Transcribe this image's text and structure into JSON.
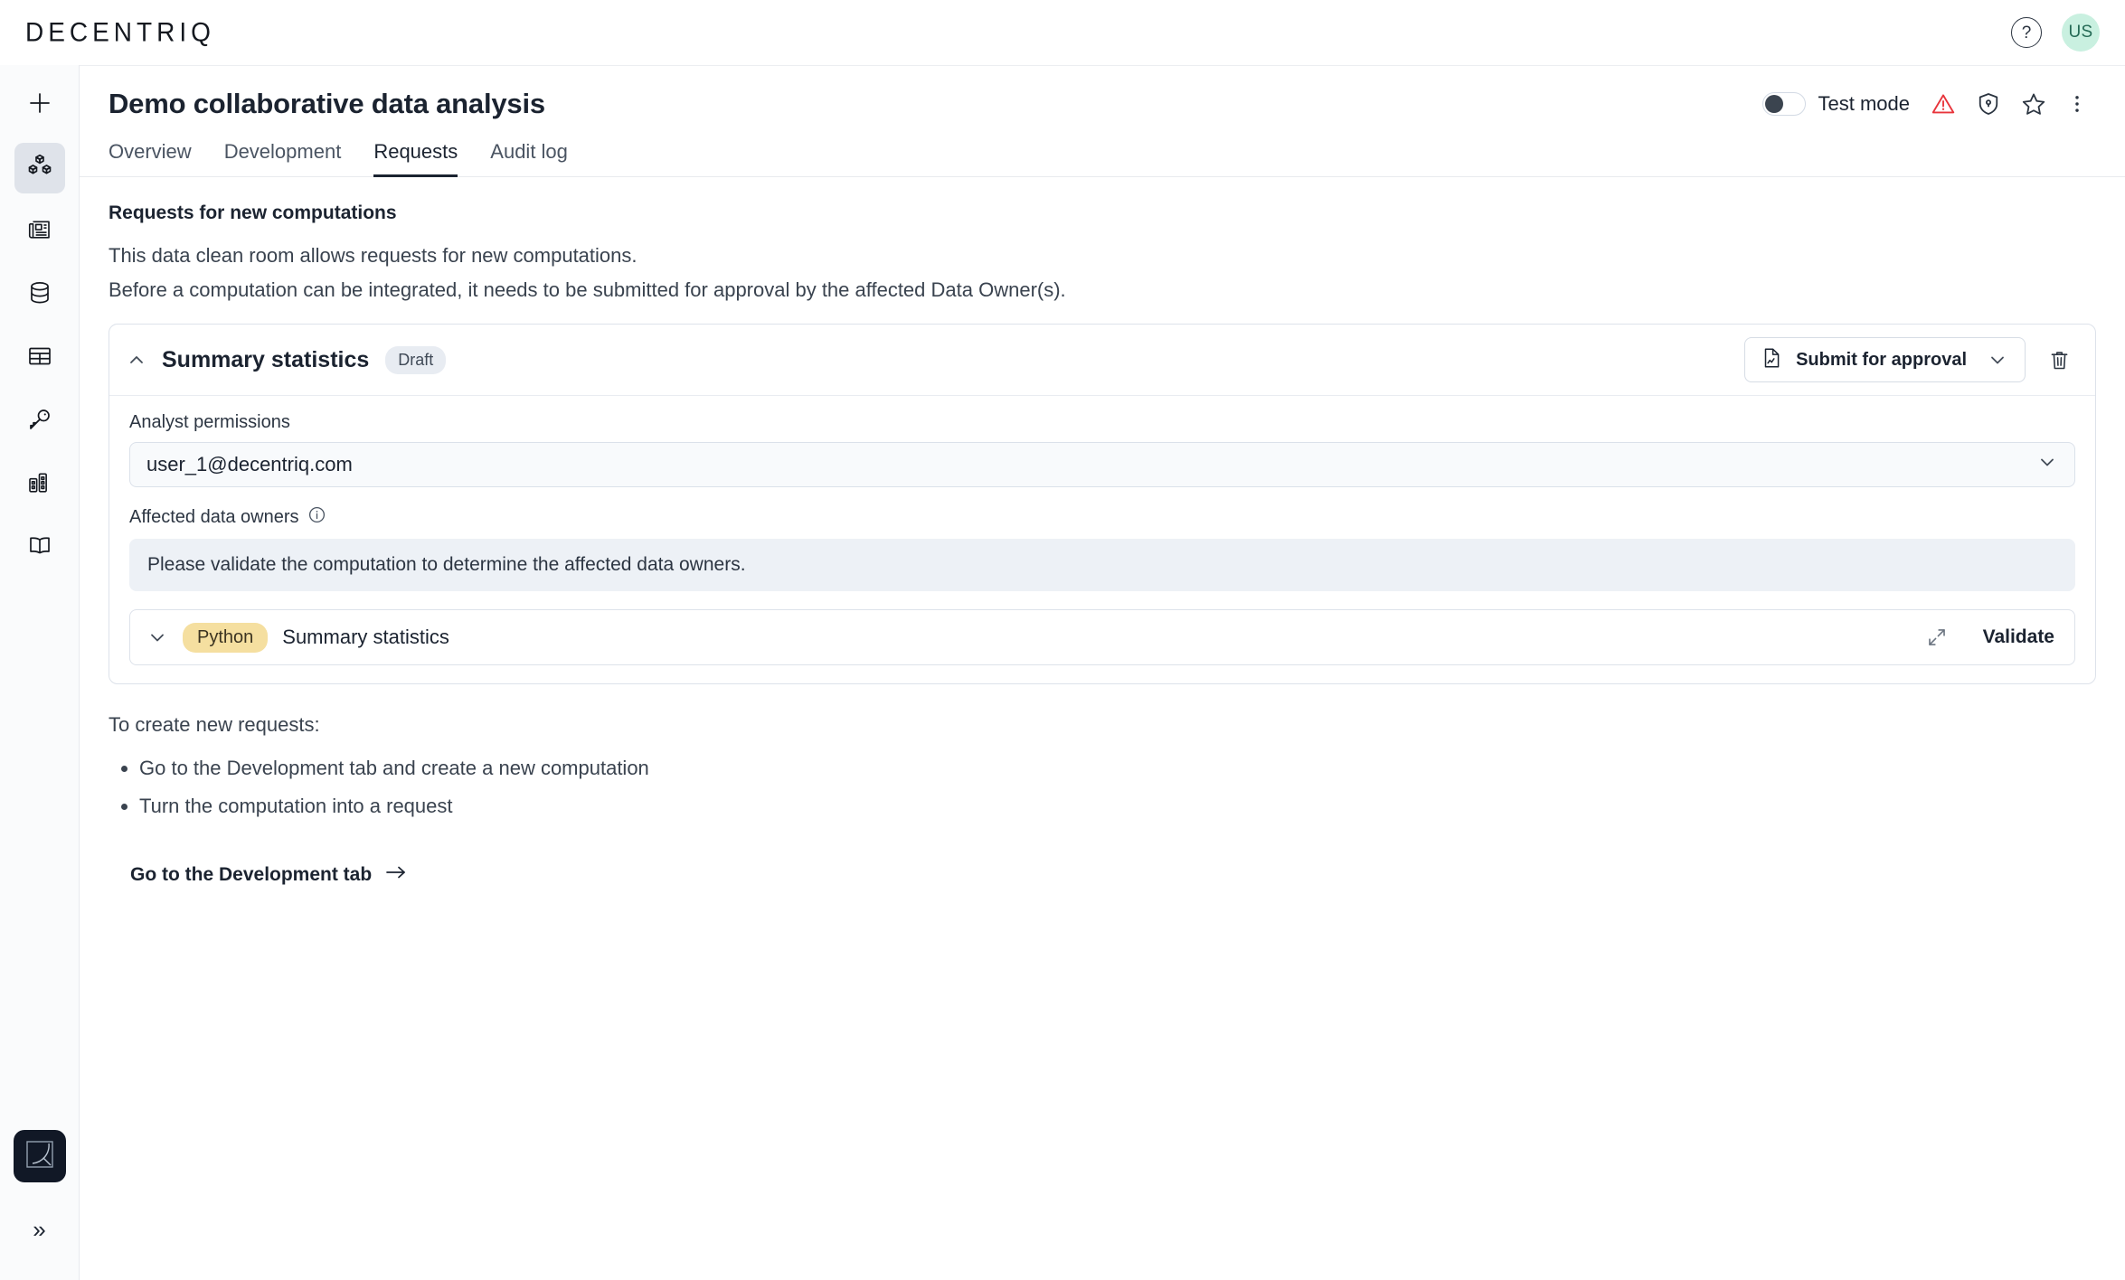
{
  "topbar": {
    "brand": "DECENTRIQ",
    "help_icon": "question-mark-circle-icon",
    "avatar_initials": "US",
    "avatar_bg": "#c9f0e0",
    "avatar_fg": "#246a55"
  },
  "sidebar": {
    "items": [
      {
        "icon": "plus-icon",
        "active": false
      },
      {
        "icon": "cubes-icon",
        "active": true
      },
      {
        "icon": "newspaper-icon",
        "active": false
      },
      {
        "icon": "database-icon",
        "active": false
      },
      {
        "icon": "table-icon",
        "active": false
      },
      {
        "icon": "key-icon",
        "active": false
      },
      {
        "icon": "buildings-icon",
        "active": false
      },
      {
        "icon": "book-icon",
        "active": false
      }
    ],
    "logo_tile_icon": "decentriq-mark-icon",
    "expand_icon": "chevron-double-right-icon",
    "expand_label": "»"
  },
  "header": {
    "title": "Demo collaborative data analysis",
    "test_mode_label": "Test mode",
    "test_mode_on": false,
    "icons": [
      {
        "name": "warning-triangle-icon",
        "color": "#e8343b"
      },
      {
        "name": "shield-keyhole-icon",
        "color": "#2b3440"
      },
      {
        "name": "star-outline-icon",
        "color": "#2b3440"
      },
      {
        "name": "more-vertical-icon",
        "color": "#2b3440"
      }
    ]
  },
  "tabs": [
    {
      "label": "Overview",
      "active": false
    },
    {
      "label": "Development",
      "active": false
    },
    {
      "label": "Requests",
      "active": true
    },
    {
      "label": "Audit log",
      "active": false
    }
  ],
  "main": {
    "section_title": "Requests for new computations",
    "description_line_1": "This data clean room allows requests for new computations.",
    "description_line_2": "Before a computation can be integrated, it needs to be submitted for approval by the affected Data Owner(s)."
  },
  "request": {
    "collapse_icon": "chevron-up-icon",
    "name": "Summary statistics",
    "status_badge": "Draft",
    "submit_button": {
      "icon": "document-chart-icon",
      "label": "Submit for approval",
      "caret_icon": "chevron-down-icon"
    },
    "delete_icon": "trash-icon",
    "analyst_permissions_label": "Analyst permissions",
    "analyst_permissions_value": "user_1@decentriq.com",
    "analyst_permissions_caret": "chevron-down-icon",
    "affected_owners_label": "Affected data owners",
    "affected_owners_info_icon": "info-circle-icon",
    "affected_owners_notice": "Please validate the computation to determine the affected data owners.",
    "computation": {
      "expand_chevron_icon": "chevron-down-icon",
      "language_badge": "Python",
      "name": "Summary statistics",
      "fullscreen_icon": "expand-arrows-icon",
      "validate_label": "Validate"
    }
  },
  "howto": {
    "intro": "To create new requests:",
    "steps": [
      "Go to the Development tab and create a new computation",
      "Turn the computation into a request"
    ],
    "link_label": "Go to the Development tab",
    "link_arrow_icon": "arrow-right-icon"
  }
}
